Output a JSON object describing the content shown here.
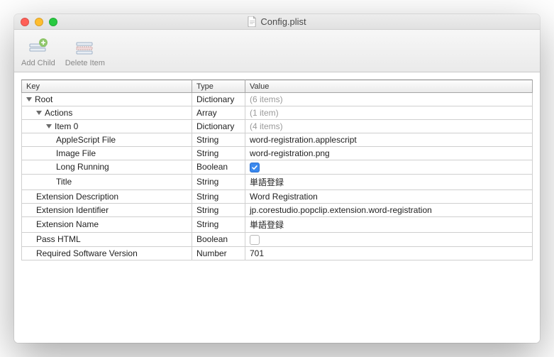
{
  "window": {
    "title": "Config.plist"
  },
  "toolbar": {
    "addChild": "Add Child",
    "deleteItem": "Delete Item"
  },
  "headers": {
    "key": "Key",
    "type": "Type",
    "value": "Value"
  },
  "rows": [
    {
      "indent": 0,
      "tri": true,
      "key": "Root",
      "type": "Dictionary",
      "value": "(6 items)",
      "muted": true,
      "check": null
    },
    {
      "indent": 1,
      "tri": true,
      "key": "Actions",
      "type": "Array",
      "value": "(1 item)",
      "muted": true,
      "check": null
    },
    {
      "indent": 2,
      "tri": true,
      "key": "Item 0",
      "type": "Dictionary",
      "value": "(4 items)",
      "muted": true,
      "check": null
    },
    {
      "indent": 3,
      "tri": false,
      "key": "AppleScript File",
      "type": "String",
      "value": "word-registration.applescript",
      "muted": false,
      "check": null
    },
    {
      "indent": 3,
      "tri": false,
      "key": "Image File",
      "type": "String",
      "value": "word-registration.png",
      "muted": false,
      "check": null
    },
    {
      "indent": 3,
      "tri": false,
      "key": "Long Running",
      "type": "Boolean",
      "value": "",
      "muted": false,
      "check": true
    },
    {
      "indent": 3,
      "tri": false,
      "key": "Title",
      "type": "String",
      "value": "単語登録",
      "muted": false,
      "check": null
    },
    {
      "indent": 1,
      "tri": false,
      "key": "Extension Description",
      "type": "String",
      "value": "Word Registration",
      "muted": false,
      "check": null
    },
    {
      "indent": 1,
      "tri": false,
      "key": "Extension Identifier",
      "type": "String",
      "value": "jp.corestudio.popclip.extension.word-registration",
      "muted": false,
      "check": null
    },
    {
      "indent": 1,
      "tri": false,
      "key": "Extension Name",
      "type": "String",
      "value": "単語登録",
      "muted": false,
      "check": null
    },
    {
      "indent": 1,
      "tri": false,
      "key": "Pass HTML",
      "type": "Boolean",
      "value": "",
      "muted": false,
      "check": false
    },
    {
      "indent": 1,
      "tri": false,
      "key": "Required Software Version",
      "type": "Number",
      "value": "701",
      "muted": false,
      "check": null
    }
  ]
}
